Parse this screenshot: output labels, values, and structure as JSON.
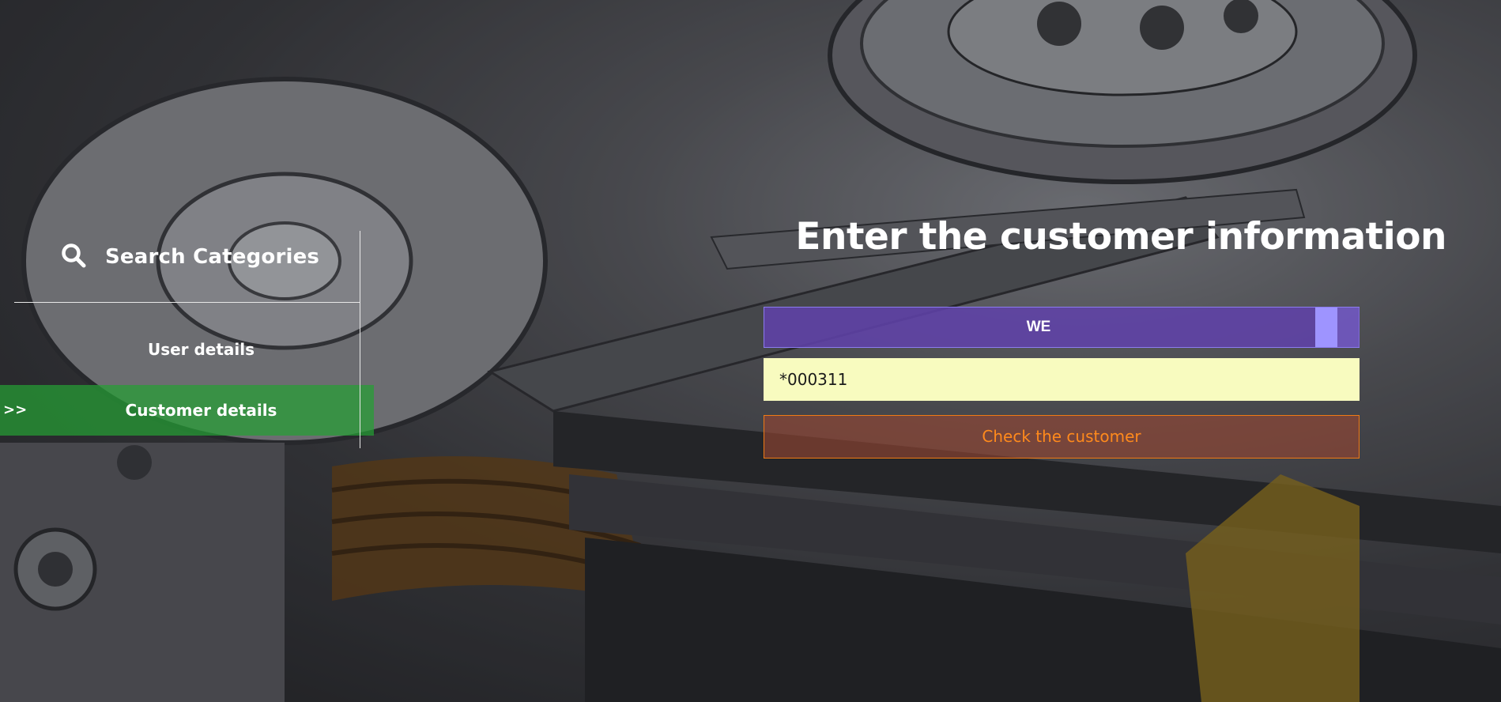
{
  "sidebar": {
    "search_label": "Search Categories",
    "items": [
      {
        "label": "User details",
        "active": false
      },
      {
        "label": "Customer details",
        "active": true,
        "marker": ">>"
      }
    ]
  },
  "main": {
    "title": "Enter the customer information",
    "select": {
      "value": "WE"
    },
    "customer_input": {
      "value": "*000311"
    },
    "check_button_label": "Check the customer"
  },
  "colors": {
    "active_item": "#26a034",
    "select_bg": "#6042a8",
    "input_bg": "#f8fbbf",
    "button_border": "#f07a14",
    "button_text": "#ff8a1c"
  },
  "icons": {
    "search": "search-icon"
  }
}
